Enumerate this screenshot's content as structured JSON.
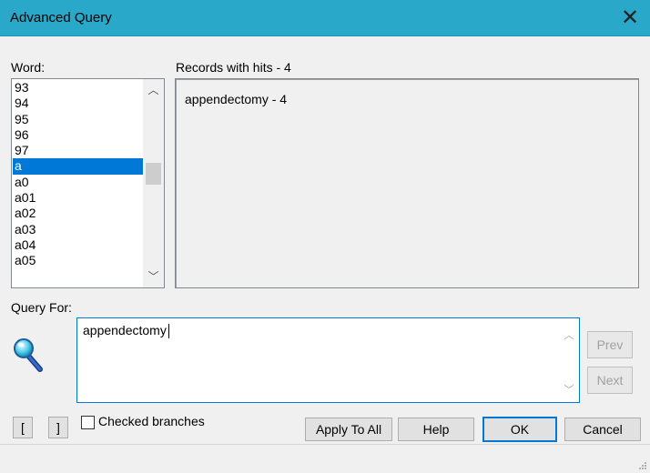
{
  "window": {
    "title": "Advanced Query",
    "close_glyph": "✕"
  },
  "word_panel": {
    "label": "Word:",
    "items": [
      "93",
      "94",
      "95",
      "96",
      "97",
      "a",
      "a0",
      "a01",
      "a02",
      "a03",
      "a04",
      "a05"
    ],
    "selected": "a"
  },
  "records_panel": {
    "label": "Records with hits - 4",
    "items": [
      "appendectomy - 4"
    ]
  },
  "query": {
    "label": "Query For:",
    "value": "appendectomy",
    "icon": "magnifier-icon"
  },
  "buttons": {
    "prev": "Prev",
    "next": "Next",
    "open_bracket": "[",
    "close_bracket": "]",
    "apply_to_all": "Apply To All",
    "help": "Help",
    "ok": "OK",
    "cancel": "Cancel"
  },
  "checked_branches": {
    "label": "Checked branches",
    "checked": false
  },
  "colors": {
    "titlebar": "#2aa8c9",
    "selection": "#0078d7",
    "focus_border": "#0078d7"
  }
}
